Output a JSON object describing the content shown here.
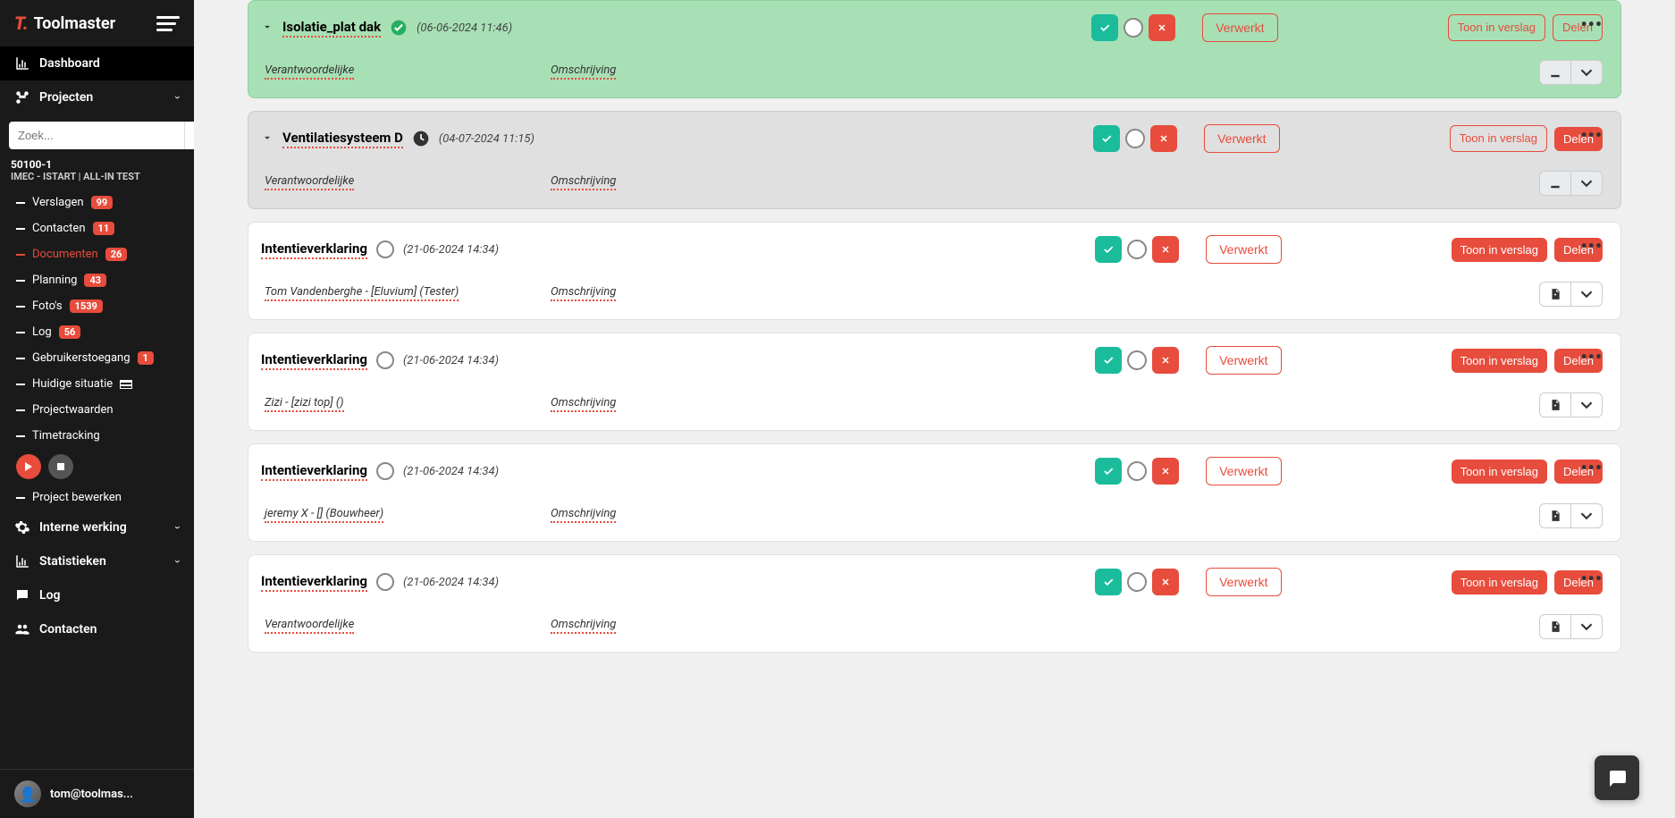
{
  "app": {
    "name": "Toolmaster"
  },
  "search": {
    "placeholder": "Zoek..."
  },
  "nav": {
    "dashboard": "Dashboard",
    "projecten": "Projecten",
    "interne": "Interne werking",
    "statistieken": "Statistieken",
    "log": "Log",
    "contacten": "Contacten"
  },
  "project": {
    "code": "50100-1",
    "name": "IMEC - ISTART | ALL-IN TEST"
  },
  "subnav": {
    "verslagen": {
      "label": "Verslagen",
      "badge": "99"
    },
    "contacten": {
      "label": "Contacten",
      "badge": "11"
    },
    "documenten": {
      "label": "Documenten",
      "badge": "26"
    },
    "planning": {
      "label": "Planning",
      "badge": "43"
    },
    "fotos": {
      "label": "Foto's",
      "badge": "1539"
    },
    "log": {
      "label": "Log",
      "badge": "56"
    },
    "gebruikerstoegang": {
      "label": "Gebruikerstoegang",
      "badge": "1"
    },
    "huidige": {
      "label": "Huidige situatie"
    },
    "projectwaarden": {
      "label": "Projectwaarden"
    },
    "timetracking": {
      "label": "Timetracking"
    },
    "bewerken": {
      "label": "Project bewerken"
    }
  },
  "user": {
    "name": "tom@toolmas..."
  },
  "labels": {
    "verantwoordelijke": "Verantwoordelijke",
    "omschrijving": "Omschrijving",
    "verwerkt": "Verwerkt",
    "toon": "Toon in verslag",
    "delen": "Delen"
  },
  "cards": [
    {
      "title": "Isolatie_plat dak",
      "ts": "(06-06-2024 11:46)",
      "type": "green",
      "expandable": true,
      "status": "check",
      "resp": "Verantwoordelijke",
      "desc": "Omschrijving",
      "toon_outline": true,
      "delen_outline": true,
      "dl_gray": true
    },
    {
      "title": "Ventilatiesysteem D",
      "ts": "(04-07-2024 11:15)",
      "type": "gray",
      "expandable": true,
      "status": "clock",
      "resp": "Verantwoordelijke",
      "desc": "Omschrijving",
      "toon_outline": true,
      "delen_outline": false,
      "dl_gray": true
    },
    {
      "title": "Intentieverklaring",
      "ts": "(21-06-2024 14:34)",
      "type": "white",
      "expandable": false,
      "status": "empty",
      "resp": "Tom Vandenberghe - [Eluvium] (Tester)",
      "desc": "Omschrijving",
      "toon_outline": false,
      "delen_outline": false,
      "dl_gray": false,
      "desc_offset": true
    },
    {
      "title": "Intentieverklaring",
      "ts": "(21-06-2024 14:34)",
      "type": "white",
      "expandable": false,
      "status": "empty",
      "resp": "Zizi - [zizi top] ()",
      "desc": "Omschrijving",
      "toon_outline": false,
      "delen_outline": false,
      "dl_gray": false
    },
    {
      "title": "Intentieverklaring",
      "ts": "(21-06-2024 14:34)",
      "type": "white",
      "expandable": false,
      "status": "empty",
      "resp": "jeremy X - [] (Bouwheer)",
      "desc": "Omschrijving",
      "toon_outline": false,
      "delen_outline": false,
      "dl_gray": false,
      "desc_offset2": true
    },
    {
      "title": "Intentieverklaring",
      "ts": "(21-06-2024 14:34)",
      "type": "white",
      "expandable": false,
      "status": "empty",
      "resp": "Verantwoordelijke",
      "desc": "Omschrijving",
      "toon_outline": false,
      "delen_outline": false,
      "dl_gray": false
    }
  ]
}
